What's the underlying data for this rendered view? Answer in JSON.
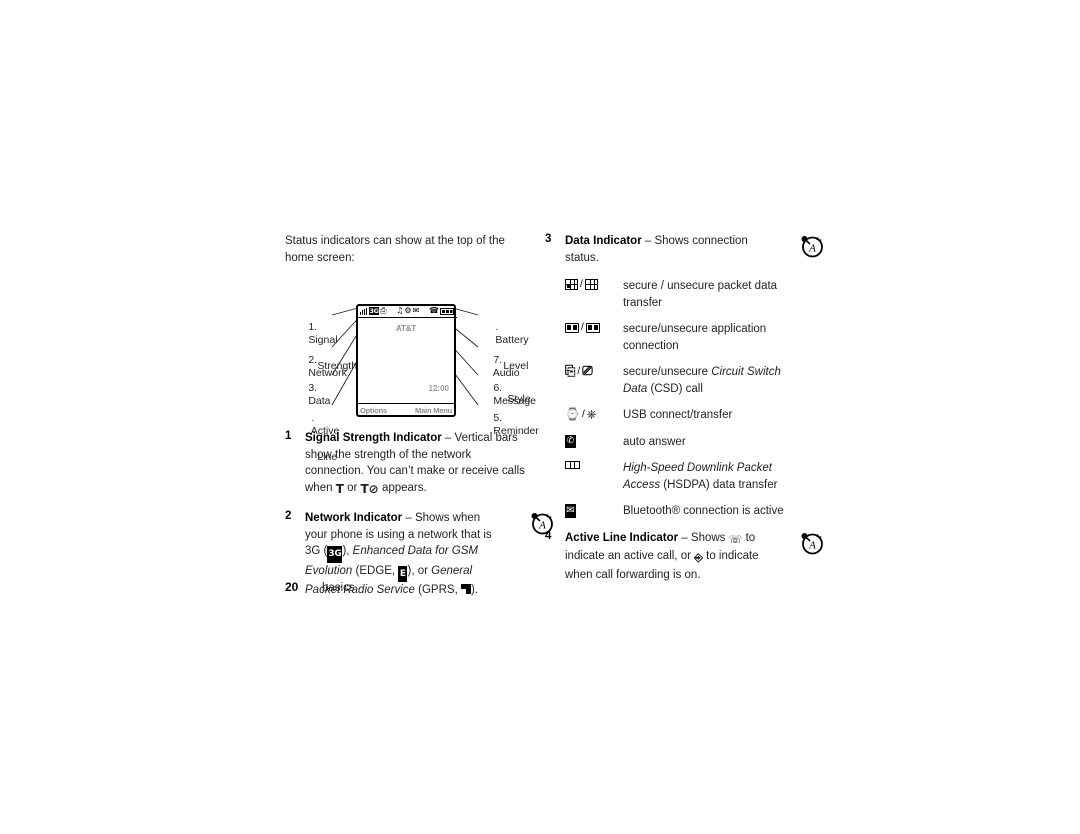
{
  "document": {
    "page_number": "20",
    "section": "basics"
  },
  "intro": {
    "text": "Status indicators can show at the top of the home screen:"
  },
  "diagram": {
    "labels_left": [
      {
        "num": "1.",
        "line1": "Signal",
        "line2": "Strength"
      },
      {
        "num": "2.",
        "line1": "Network",
        "line2": ""
      },
      {
        "num": "3.",
        "line1": "Data",
        "line2": ""
      },
      {
        "num": ".",
        "line1": "Active",
        "line2": "Line"
      }
    ],
    "labels_right": [
      {
        "num": ".",
        "line1": "Battery",
        "line2": "Level"
      },
      {
        "num": "7.",
        "line1": "Audio",
        "line2": "Style"
      },
      {
        "num": "6.",
        "line1": "Message",
        "line2": ""
      },
      {
        "num": "5.",
        "line1": "Reminder",
        "line2": ""
      }
    ],
    "phone": {
      "carrier": "AT&T",
      "time": "12:00",
      "softkey_left": "Options",
      "softkey_right": "Main Menu",
      "status_icons": [
        "signal-strength-icon",
        "3g-network-icon",
        "data-packet-icon",
        "audio-style-icon",
        "reminder-icon",
        "message-icon",
        "active-line-icon",
        "battery-level-icon"
      ],
      "3g_label": "3G"
    }
  },
  "items": [
    {
      "num": "1",
      "title": "Signal Strength Indicator",
      "dash": " – ",
      "body_1": "Vertical bars show the strength of the network connection. You can’t make or receive calls when ",
      "glyph_a": "T",
      "mid": " or ",
      "glyph_b": "T⊘",
      "body_2": " appears.",
      "has_note": false
    },
    {
      "num": "2",
      "title": "Network Indicator",
      "dash": " – ",
      "body_1": "Shows when your phone is using a network that is 3G (",
      "glyph_3g": "3G",
      "body_2": "), ",
      "italic_1": "Enhanced Data for GSM Evolution",
      "body_3": " (EDGE, ",
      "glyph_edge": "E",
      "body_4": "), or ",
      "italic_2": "General Packet Radio Service",
      "body_5": " (GPRS, ",
      "body_6": ").",
      "has_note": true
    },
    {
      "num": "3",
      "title": "Data Indicator",
      "dash": " – ",
      "body_1": "Shows connection status.",
      "has_note": true
    },
    {
      "num": "4",
      "title": "Active Line Indicator",
      "dash": " – ",
      "body_1": "Shows ",
      "body_2": " to indicate an active call, or ",
      "body_3": " to indicate when call forwarding is on.",
      "has_note": true
    }
  ],
  "data_indicator_table": {
    "rows": [
      {
        "icons": [
          "packet-data-secure-icon",
          "packet-data-unsecure-icon"
        ],
        "desc_plain": "secure / unsecure packet data transfer",
        "desc_italic": "",
        "desc_tail": ""
      },
      {
        "icons": [
          "application-secure-icon",
          "application-unsecure-icon"
        ],
        "desc_plain": "secure/unsecure application connection",
        "desc_italic": "",
        "desc_tail": ""
      },
      {
        "icons": [
          "csd-secure-icon",
          "csd-unsecure-icon"
        ],
        "desc_plain": "secure/unsecure ",
        "desc_italic": "Circuit Switch Data",
        "desc_tail": " (CSD) call"
      },
      {
        "icons": [
          "usb-connect-icon",
          "usb-transfer-icon"
        ],
        "desc_plain": "USB connect/transfer",
        "desc_italic": "",
        "desc_tail": ""
      },
      {
        "icons": [
          "auto-answer-icon"
        ],
        "desc_plain": "auto answer",
        "desc_italic": "",
        "desc_tail": ""
      },
      {
        "icons": [
          "hsdpa-icon"
        ],
        "desc_plain": "",
        "desc_italic": "High-Speed Downlink Packet Access",
        "desc_tail": " (HSDPA) data transfer"
      },
      {
        "icons": [
          "bluetooth-icon"
        ],
        "desc_plain": "Bluetooth® connection is active",
        "desc_italic": "",
        "desc_tail": ""
      }
    ]
  },
  "note_badge": {
    "name": "network-note-icon",
    "letter": "A"
  },
  "colors": {
    "text": "#231f20",
    "heading": "#000000",
    "screen_gray": "#8d8d8d",
    "page_background": "#ffffff"
  }
}
